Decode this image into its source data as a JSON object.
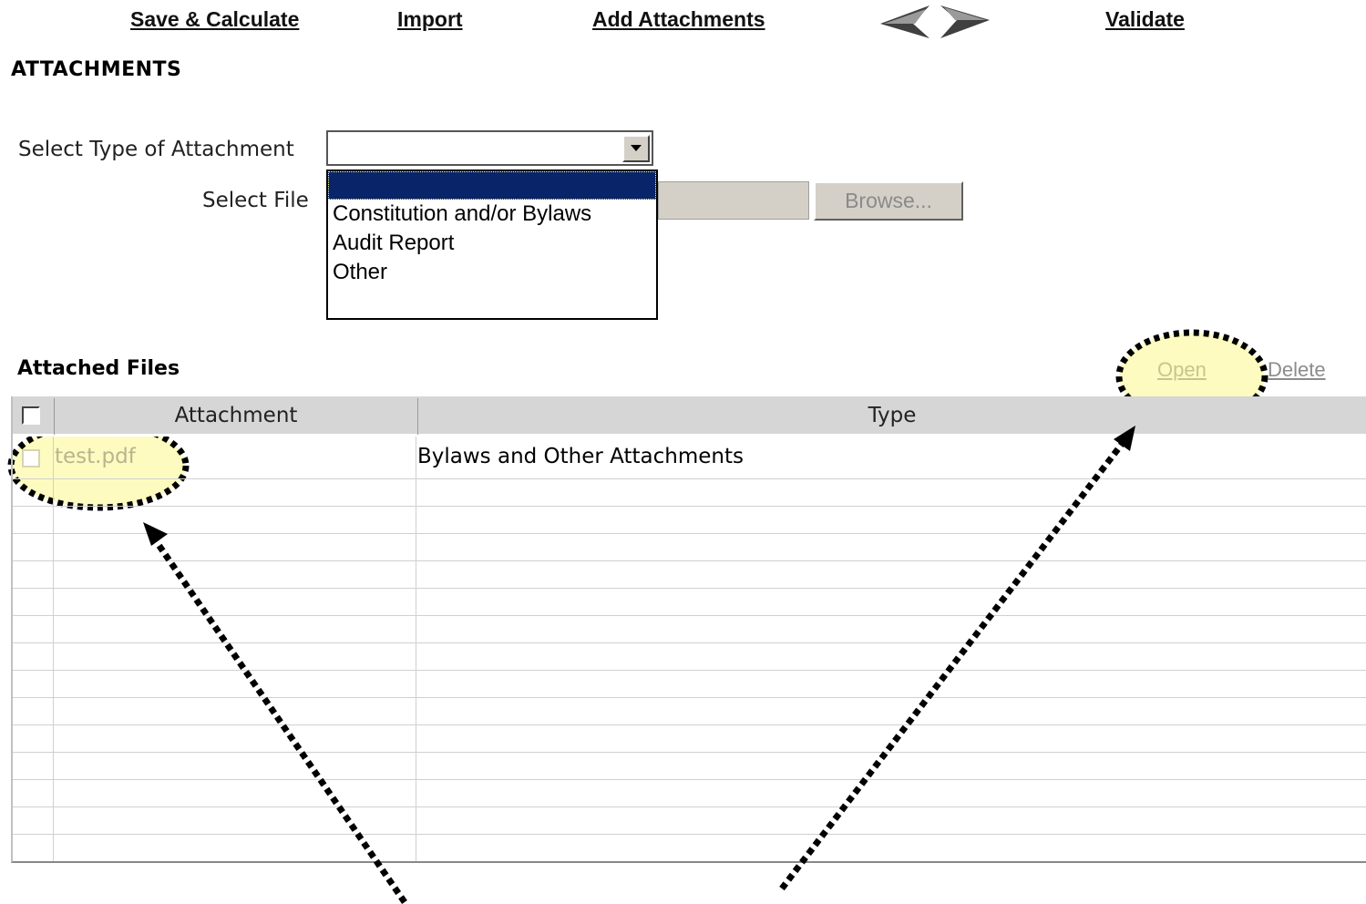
{
  "toolbar": {
    "save_calculate": "Save & Calculate",
    "import": "Import",
    "add_attachments": "Add Attachments",
    "validate": "Validate"
  },
  "section": {
    "title": "ATTACHMENTS"
  },
  "form": {
    "type_label": "Select Type of Attachment",
    "type_value": "",
    "type_options": [
      "",
      "Constitution and/or Bylaws",
      "Audit Report",
      "Other"
    ],
    "file_label": "Select File",
    "browse_label": "Browse..."
  },
  "attached_files": {
    "title": "Attached Files",
    "actions": {
      "open": "Open",
      "delete": "Delete"
    },
    "columns": [
      "Attachment",
      "Type"
    ],
    "rows": [
      {
        "attachment": "test.pdf",
        "type": "Bylaws and Other Attachments"
      }
    ]
  },
  "colors": {
    "highlight_fill": "#fdfbc0",
    "dropdown_selected": "#0a246a",
    "header_bg": "#d6d6d6",
    "disabled_text": "#b9b48e"
  }
}
